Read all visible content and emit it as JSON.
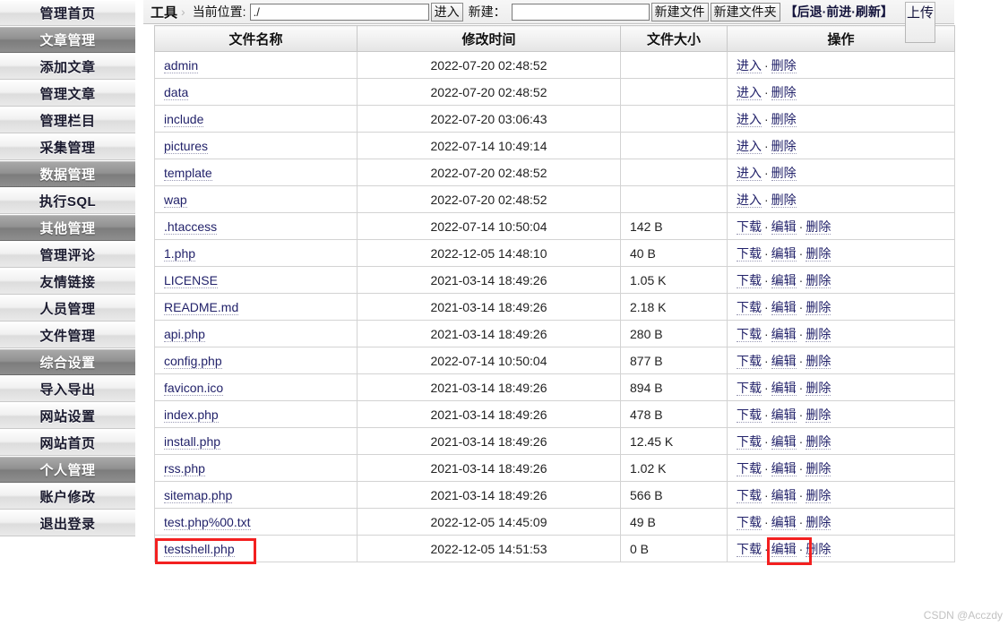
{
  "sidebar": {
    "items": [
      {
        "label": "管理首页",
        "type": "normal"
      },
      {
        "label": "文章管理",
        "type": "header"
      },
      {
        "label": "添加文章",
        "type": "normal"
      },
      {
        "label": "管理文章",
        "type": "normal"
      },
      {
        "label": "管理栏目",
        "type": "normal"
      },
      {
        "label": "采集管理",
        "type": "normal"
      },
      {
        "label": "数据管理",
        "type": "header"
      },
      {
        "label": "执行SQL",
        "type": "normal"
      },
      {
        "label": "其他管理",
        "type": "header"
      },
      {
        "label": "管理评论",
        "type": "normal"
      },
      {
        "label": "友情链接",
        "type": "normal"
      },
      {
        "label": "人员管理",
        "type": "normal"
      },
      {
        "label": "文件管理",
        "type": "normal"
      },
      {
        "label": "综合设置",
        "type": "header"
      },
      {
        "label": "导入导出",
        "type": "normal"
      },
      {
        "label": "网站设置",
        "type": "normal"
      },
      {
        "label": "网站首页",
        "type": "normal"
      },
      {
        "label": "个人管理",
        "type": "header"
      },
      {
        "label": "账户修改",
        "type": "normal"
      },
      {
        "label": "退出登录",
        "type": "normal"
      }
    ]
  },
  "toolbar": {
    "tool_title": "工具",
    "crumb_arrow": "›",
    "path_label": "当前位置:",
    "path_value": "./",
    "enter_button": "进入",
    "new_label": "新建：",
    "new_value": "",
    "new_file_button": "新建文件",
    "new_folder_button": "新建文件夹",
    "nav_commands": "【后退·前进·刷新】",
    "upload_button": "上传"
  },
  "table": {
    "headers": {
      "name": "文件名称",
      "time": "修改时间",
      "size": "文件大小",
      "action": "操作"
    },
    "actions": {
      "enter": "进入",
      "download": "下载",
      "edit": "编辑",
      "delete": "删除",
      "separator": "·"
    },
    "rows": [
      {
        "name": "admin",
        "time": "2022-07-20 02:48:52",
        "size": "",
        "kind": "dir"
      },
      {
        "name": "data",
        "time": "2022-07-20 02:48:52",
        "size": "",
        "kind": "dir"
      },
      {
        "name": "include",
        "time": "2022-07-20 03:06:43",
        "size": "",
        "kind": "dir"
      },
      {
        "name": "pictures",
        "time": "2022-07-14 10:49:14",
        "size": "",
        "kind": "dir"
      },
      {
        "name": "template",
        "time": "2022-07-20 02:48:52",
        "size": "",
        "kind": "dir"
      },
      {
        "name": "wap",
        "time": "2022-07-20 02:48:52",
        "size": "",
        "kind": "dir"
      },
      {
        "name": ".htaccess",
        "time": "2022-07-14 10:50:04",
        "size": "142 B",
        "kind": "file"
      },
      {
        "name": "1.php",
        "time": "2022-12-05 14:48:10",
        "size": "40 B",
        "kind": "file"
      },
      {
        "name": "LICENSE",
        "time": "2021-03-14 18:49:26",
        "size": "1.05 K",
        "kind": "file"
      },
      {
        "name": "README.md",
        "time": "2021-03-14 18:49:26",
        "size": "2.18 K",
        "kind": "file"
      },
      {
        "name": "api.php",
        "time": "2021-03-14 18:49:26",
        "size": "280 B",
        "kind": "file"
      },
      {
        "name": "config.php",
        "time": "2022-07-14 10:50:04",
        "size": "877 B",
        "kind": "file"
      },
      {
        "name": "favicon.ico",
        "time": "2021-03-14 18:49:26",
        "size": "894 B",
        "kind": "file"
      },
      {
        "name": "index.php",
        "time": "2021-03-14 18:49:26",
        "size": "478 B",
        "kind": "file"
      },
      {
        "name": "install.php",
        "time": "2021-03-14 18:49:26",
        "size": "12.45 K",
        "kind": "file"
      },
      {
        "name": "rss.php",
        "time": "2021-03-14 18:49:26",
        "size": "1.02 K",
        "kind": "file"
      },
      {
        "name": "sitemap.php",
        "time": "2021-03-14 18:49:26",
        "size": "566 B",
        "kind": "file"
      },
      {
        "name": "test.php%00.txt",
        "time": "2022-12-05 14:45:09",
        "size": "49 B",
        "kind": "file"
      },
      {
        "name": "testshell.php",
        "time": "2022-12-05 14:51:53",
        "size": "0 B",
        "kind": "file"
      }
    ]
  },
  "annotations": {
    "highlight_color": "#f32020",
    "highlighted_filename": "testshell.php",
    "highlighted_action": "编辑"
  },
  "watermark": {
    "text": "CSDN @Acczdy"
  }
}
